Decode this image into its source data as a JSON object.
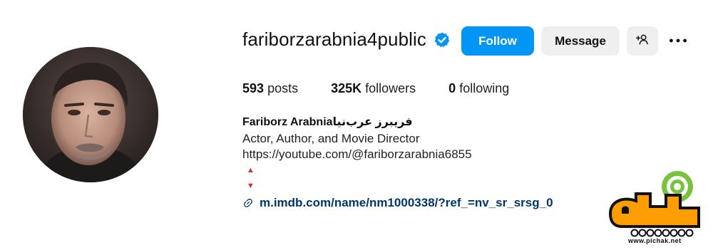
{
  "profile": {
    "username": "fariborzarabnia4public",
    "full_name": "Fariborz Arabniaفریبرز عرب‌نیا",
    "bio_line1": "Actor, Author, and Movie Director",
    "bio_line2": "https://youtube.com/@fariborzarabnia6855",
    "arrow_up": "▲",
    "arrow_down": "▼",
    "link": "m.imdb.com/name/nm1000338/?ref_=nv_sr_srsg_0"
  },
  "actions": {
    "follow_label": "Follow",
    "message_label": "Message"
  },
  "stats": {
    "posts_count": "593",
    "posts_label": "posts",
    "followers_count": "325K",
    "followers_label": "followers",
    "following_count": "0",
    "following_label": "following"
  },
  "watermark": {
    "url": "www.pichak.net"
  },
  "icons": {
    "verified": "verified-badge-icon",
    "add_user": "add-user-icon",
    "more": "more-options-icon",
    "link": "link-icon"
  },
  "colors": {
    "accent": "#0095f6",
    "link": "#00376b",
    "secondary_button": "#efefef",
    "arrow": "#d92b2b"
  }
}
